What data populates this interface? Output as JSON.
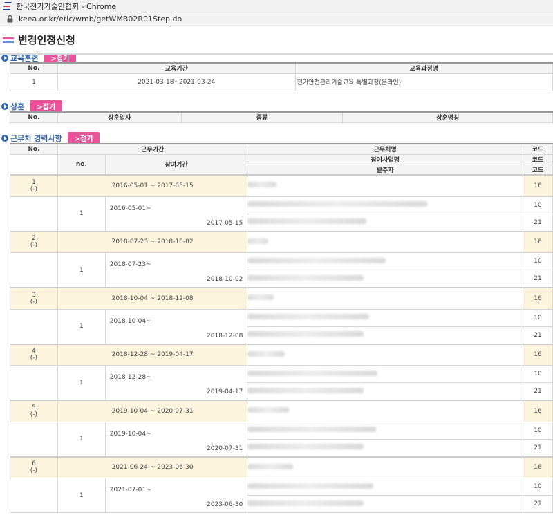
{
  "browser": {
    "window_title": "한국전기기술인협회 - Chrome",
    "url": "keea.or.kr/etic/wmb/getWMB02R01Step.do"
  },
  "page": {
    "title": "변경인정신청"
  },
  "education": {
    "heading": "교육훈련",
    "fold_label": ">접기",
    "headers": [
      "No.",
      "교육기간",
      "교육과정명"
    ],
    "rows": [
      {
        "no": "1",
        "period": "2021-03-18~2021-03-24",
        "course": "전기안전관리기술교육 특별과정(온라인)"
      }
    ]
  },
  "awards": {
    "heading": "상훈",
    "fold_label": ">접기",
    "headers": [
      "No.",
      "상훈일자",
      "종류",
      "상훈명칭"
    ]
  },
  "career": {
    "heading": "근무처 경력사항",
    "fold_label": ">접기",
    "headers": {
      "no": "No.",
      "period": "근무기간",
      "workplace": "근무처명",
      "code": "코드",
      "sub_no": "no.",
      "participation": "참여기간",
      "project": "참여사업명",
      "client": "발주자"
    },
    "entries": [
      {
        "no": "1",
        "sub": "(-)",
        "period": "2016-05-01 ~ 2017-05-15",
        "code": "16",
        "detail": {
          "no": "1",
          "start": "2016-05-01~",
          "end": "2017-05-15",
          "code_project": "10",
          "code_client": "21"
        }
      },
      {
        "no": "2",
        "sub": "(-)",
        "period": "2018-07-23 ~ 2018-10-02",
        "code": "16",
        "detail": {
          "no": "1",
          "start": "2018-07-23~",
          "end": "2018-10-02",
          "code_project": "10",
          "code_client": "21"
        }
      },
      {
        "no": "3",
        "sub": "(-)",
        "period": "2018-10-04 ~ 2018-12-08",
        "code": "16",
        "detail": {
          "no": "1",
          "start": "2018-10-04~",
          "end": "2018-12-08",
          "code_project": "10",
          "code_client": "21"
        }
      },
      {
        "no": "4",
        "sub": "(-)",
        "period": "2018-12-28 ~ 2019-04-17",
        "code": "16",
        "detail": {
          "no": "1",
          "start": "2018-12-28~",
          "end": "2019-04-17",
          "code_project": "10",
          "code_client": "21"
        }
      },
      {
        "no": "5",
        "sub": "(-)",
        "period": "2019-10-04 ~ 2020-07-31",
        "code": "16",
        "detail": {
          "no": "1",
          "start": "2019-10-04~",
          "end": "2020-07-31",
          "code_project": "10",
          "code_client": "21"
        }
      },
      {
        "no": "6",
        "sub": "(-)",
        "period": "2021-06-24 ~ 2023-06-30",
        "code": "16",
        "detail": {
          "no": "1",
          "start": "2021-07-01~",
          "end": "2023-06-30",
          "code_project": "10",
          "code_client": "21"
        }
      }
    ]
  },
  "colors": {
    "accent_pink": "#e8539a",
    "section_blue": "#2d66b7",
    "highlight_row": "#fcf4dd"
  }
}
